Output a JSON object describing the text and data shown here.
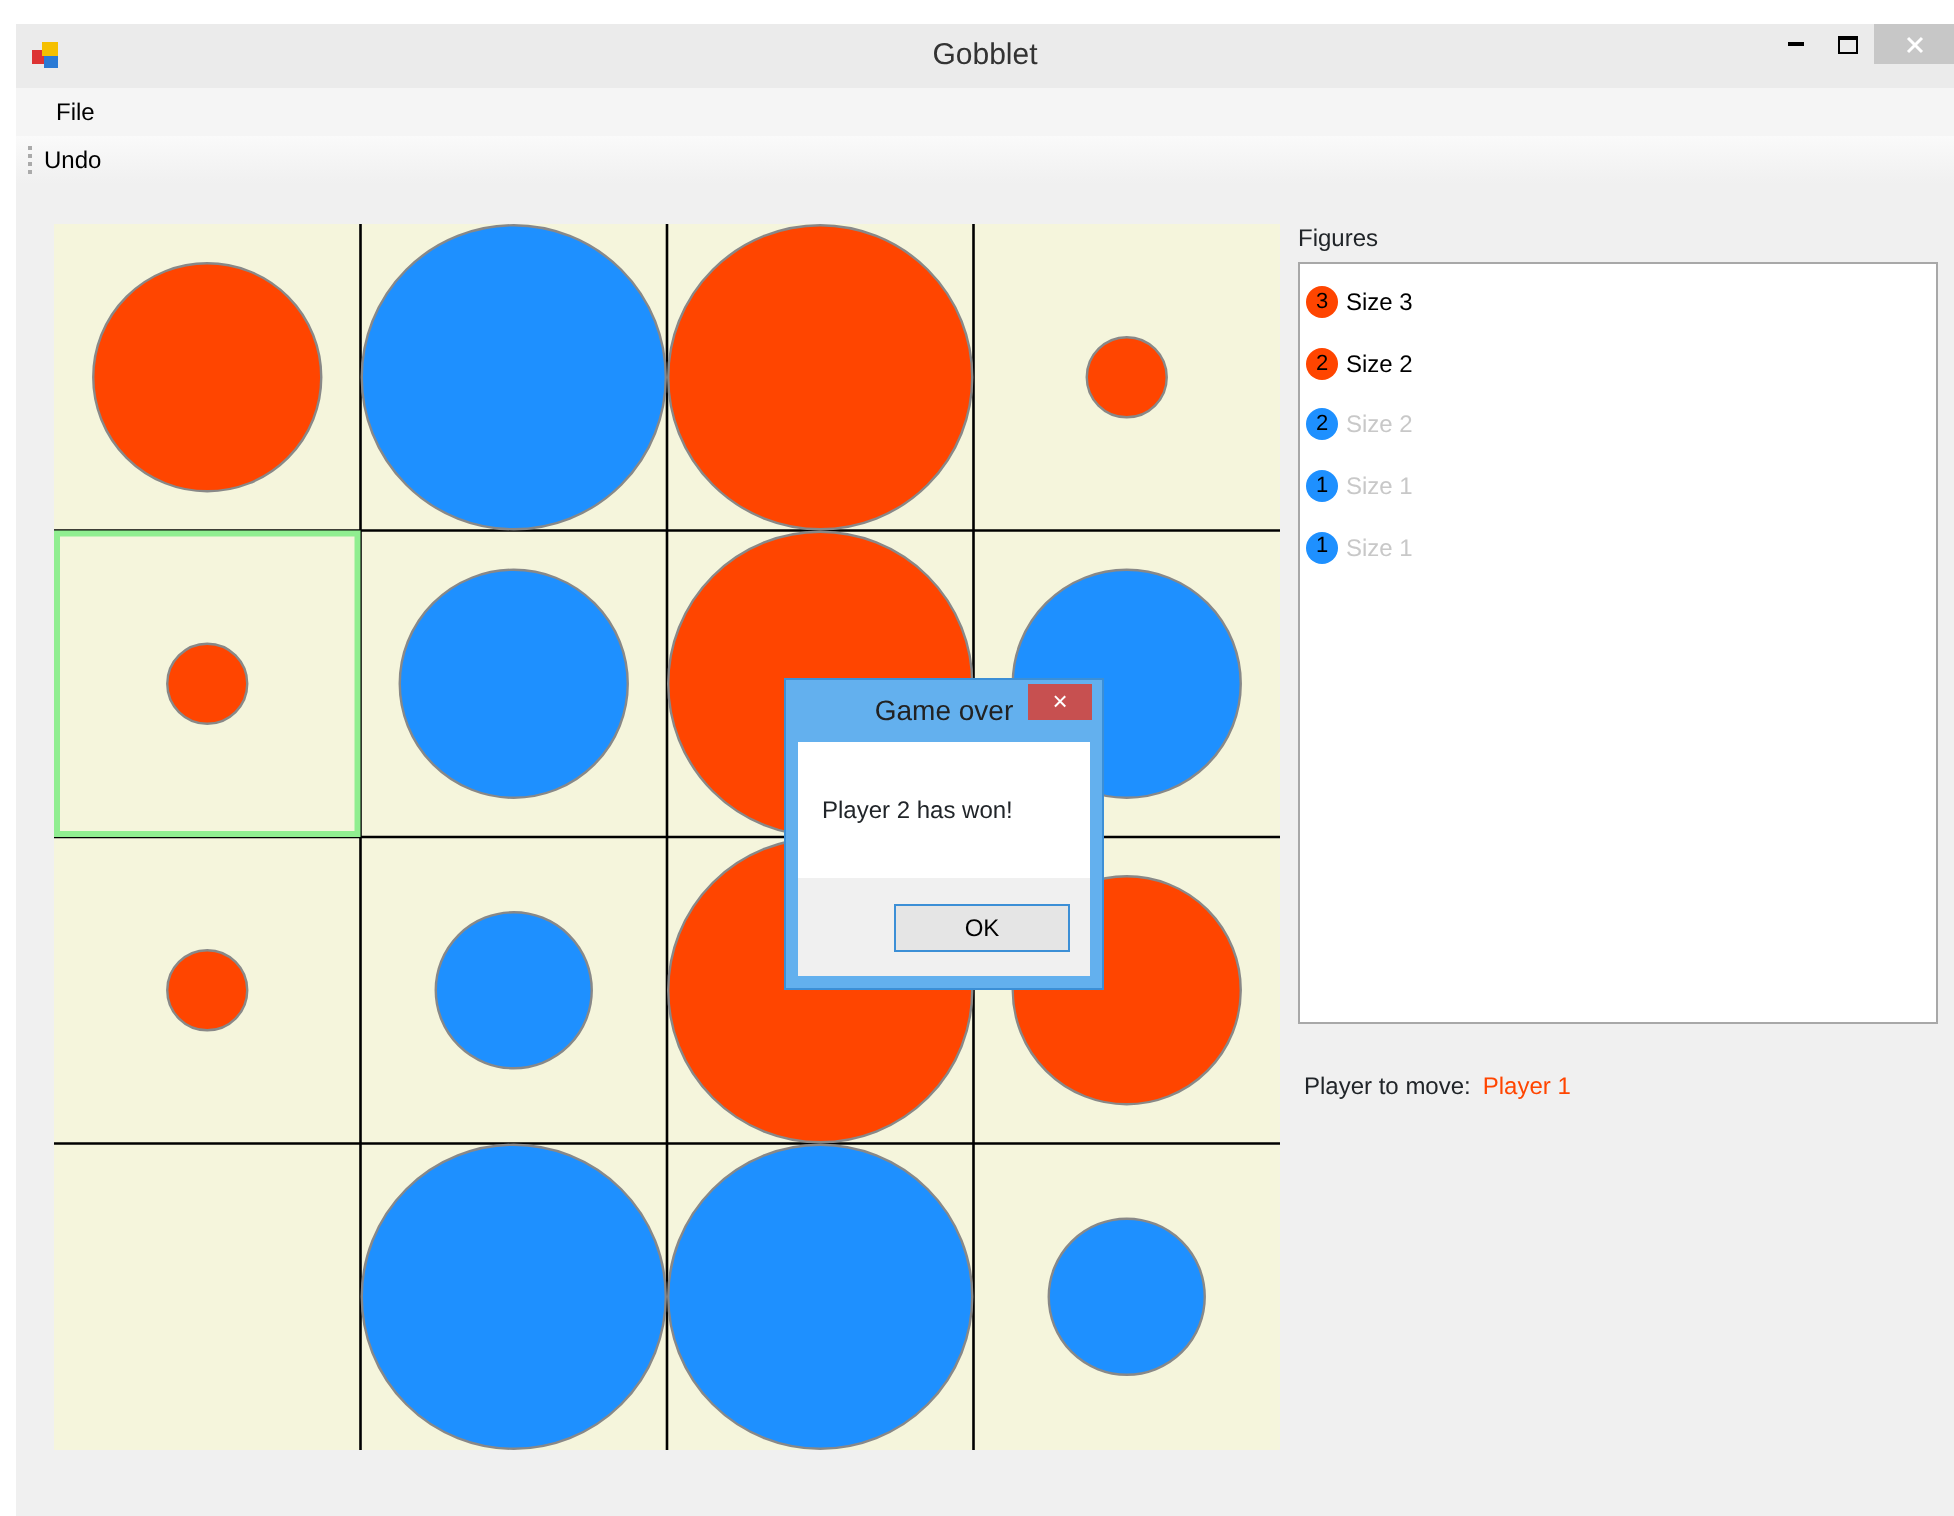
{
  "window": {
    "title": "Gobblet"
  },
  "menu": [
    "File"
  ],
  "toolbar": [
    "Undo"
  ],
  "board": {
    "rows": [
      [
        {
          "selected": false,
          "piece": {
            "color": "#ff4500",
            "kind": "medium"
          }
        },
        {
          "selected": false,
          "piece": {
            "color": "#1e90ff",
            "kind": "large"
          }
        },
        {
          "selected": false,
          "piece": {
            "color": "#ff4500",
            "kind": "large"
          }
        },
        {
          "selected": false,
          "piece": {
            "color": "#ff4500",
            "kind": "tiny"
          }
        }
      ],
      [
        {
          "selected": true,
          "piece": {
            "color": "#ff4500",
            "kind": "tiny"
          }
        },
        {
          "selected": false,
          "piece": {
            "color": "#1e90ff",
            "kind": "medium"
          }
        },
        {
          "selected": false,
          "piece": {
            "color": "#ff4500",
            "kind": "large"
          }
        },
        {
          "selected": false,
          "piece": {
            "color": "#1e90ff",
            "kind": "medium"
          }
        }
      ],
      [
        {
          "selected": false,
          "piece": {
            "color": "#ff4500",
            "kind": "tiny"
          }
        },
        {
          "selected": false,
          "piece": {
            "color": "#1e90ff",
            "kind": "small"
          }
        },
        {
          "selected": false,
          "piece": {
            "color": "#ff4500",
            "kind": "large"
          }
        },
        {
          "selected": false,
          "piece": {
            "color": "#ff4500",
            "kind": "medium"
          }
        }
      ],
      [
        {
          "selected": false
        },
        {
          "selected": false,
          "piece": {
            "color": "#1e90ff",
            "kind": "large"
          }
        },
        {
          "selected": false,
          "piece": {
            "color": "#1e90ff",
            "kind": "large"
          }
        },
        {
          "selected": false,
          "piece": {
            "color": "#1e90ff",
            "kind": "small"
          }
        }
      ]
    ]
  },
  "figures": {
    "label": "Figures",
    "items": [
      {
        "badge": "3",
        "label": "Size 3",
        "color": "#ff4500",
        "disabled": false
      },
      {
        "badge": "2",
        "label": "Size 2",
        "color": "#ff4500",
        "disabled": false
      },
      {
        "badge": "2",
        "label": "Size 2",
        "color": "#1e90ff",
        "disabled": true
      },
      {
        "badge": "1",
        "label": "Size 1",
        "color": "#1e90ff",
        "disabled": true
      },
      {
        "badge": "1",
        "label": "Size 1",
        "color": "#1e90ff",
        "disabled": true
      }
    ]
  },
  "player_to_move": {
    "label": "Player to move:",
    "value": "Player 1"
  },
  "dialog": {
    "title": "Game over",
    "close": "×",
    "message": "Player 2 has won!",
    "button": "OK"
  }
}
